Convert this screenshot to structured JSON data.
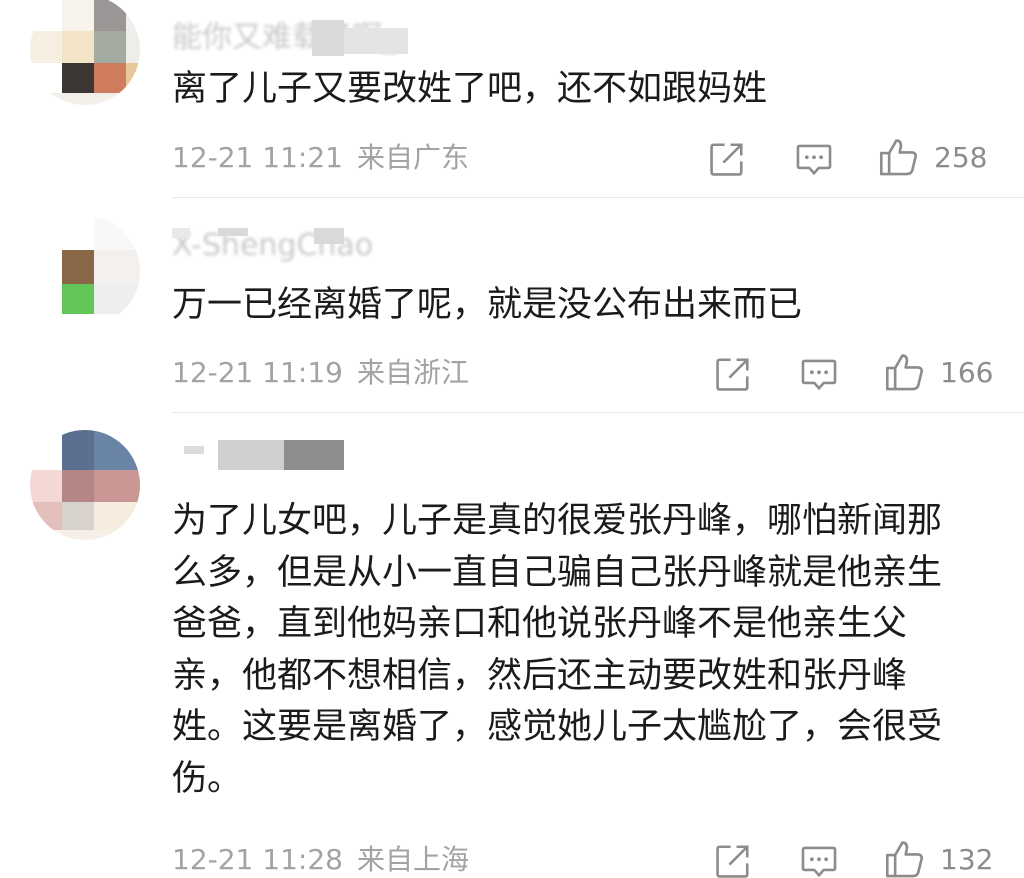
{
  "comments": [
    {
      "username": "能你又难载了啊_",
      "text": "离了儿子又要改姓了吧，还不如跟妈姓",
      "date": "12-21 11:21",
      "location": "来自广东",
      "likes": "258"
    },
    {
      "username": "X-ShengChao",
      "text": "万一已经离婚了呢，就是没公布出来而已",
      "date": "12-21 11:19",
      "location": "来自浙江",
      "likes": "166"
    },
    {
      "username": "",
      "text": "为了儿女吧，儿子是真的很爱张丹峰，哪怕新闻那么多，但是从小一直自己骗自己张丹峰就是他亲生爸爸，直到他妈亲口和他说张丹峰不是他亲生父亲，他都不想相信，然后还主动要改姓和张丹峰姓。这要是离婚了，感觉她儿子太尴尬了，会很受伤。",
      "date": "12-21 11:28",
      "location": "来自上海",
      "likes": "132"
    }
  ],
  "icons": {
    "share": "share-icon",
    "comment": "comment-icon",
    "like": "thumbs-up-icon"
  },
  "colors": {
    "text": "#1b1b1b",
    "meta": "#a3a3a3",
    "icon": "#8c8c8c",
    "divider": "#e6e6e6"
  }
}
